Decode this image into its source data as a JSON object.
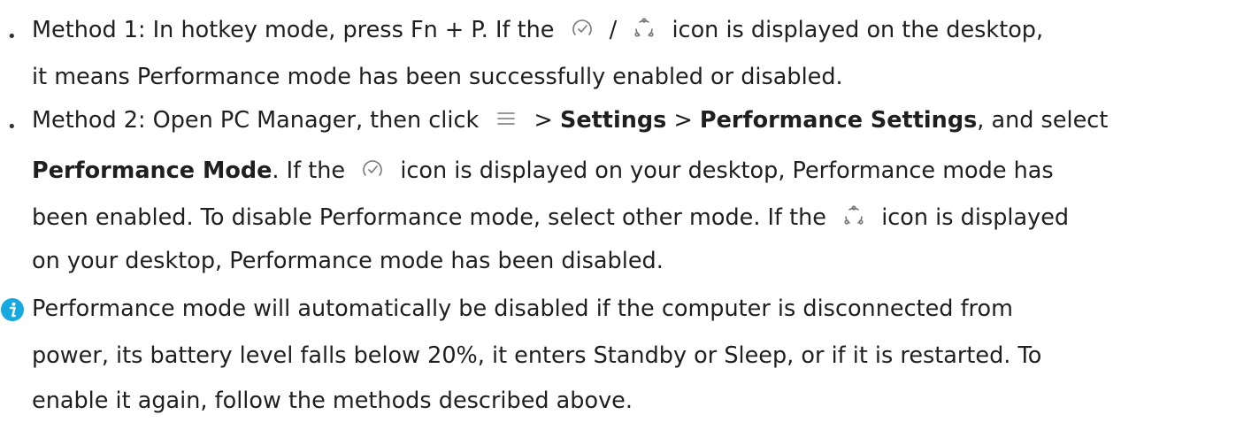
{
  "method1": {
    "line1_a": "Method 1: In hotkey mode, press Fn + P. If the",
    "line1_sep": "/",
    "line1_b": "icon is displayed on the desktop,",
    "line2": "it means Performance mode has been successfully enabled or disabled."
  },
  "method2": {
    "line1_a": "Method 2: Open PC Manager, then click",
    "line1_gt1": ">",
    "line1_settings": "Settings",
    "line1_gt2": ">",
    "line1_perf_settings": "Performance Settings",
    "line1_b": ", and select",
    "line2_perf_mode": "Performance Mode",
    "line2_a": ". If the",
    "line2_b": "icon is displayed on your desktop, Performance mode has",
    "line3_a": "been enabled. To disable Performance mode, select other mode. If the",
    "line3_b": "icon is displayed",
    "line4": "on your desktop, Performance mode has been disabled."
  },
  "note": {
    "line1": "Performance mode will automatically be disabled if the computer is disconnected from",
    "line2": "power, its battery level falls below 20%, it enters Standby or Sleep, or if it is restarted. To",
    "line3": "enable it again, follow the methods described above."
  },
  "icons": {
    "performance": "performance-mode-icon",
    "normal": "normal-mode-icon",
    "menu": "menu-icon",
    "info": "info-icon"
  },
  "colors": {
    "info_icon": "#16a9e0",
    "icon_stroke": "#777777"
  }
}
